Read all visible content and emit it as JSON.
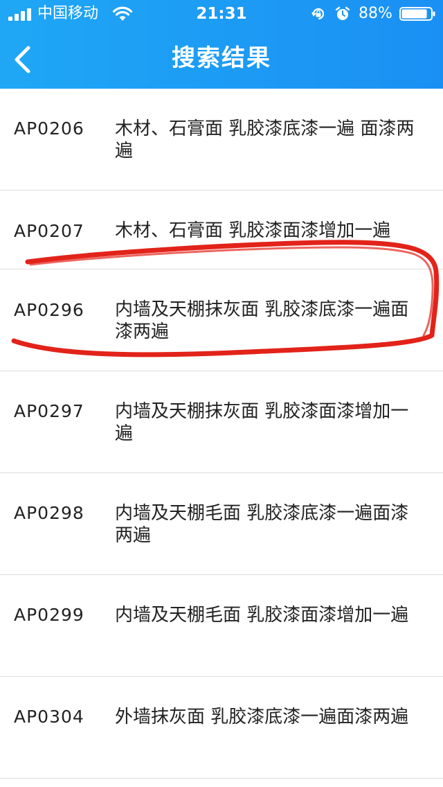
{
  "status_bar": {
    "carrier": "中国移动",
    "time": "21:31",
    "battery_percent": "88%",
    "battery_level": 0.88,
    "icons": [
      "signal-icon",
      "wifi-icon",
      "orientation-lock-icon",
      "alarm-icon",
      "battery-icon"
    ]
  },
  "nav": {
    "back_icon": "chevron-left-icon",
    "title": "搜索结果"
  },
  "results": [
    {
      "code": "AP0206",
      "desc": "木材、石膏面 乳胶漆底漆一遍 面漆两遍"
    },
    {
      "code": "AP0207",
      "desc": "木材、石膏面 乳胶漆面漆增加一遍"
    },
    {
      "code": "AP0296",
      "desc": "内墙及天棚抹灰面 乳胶漆底漆一遍面漆两遍"
    },
    {
      "code": "AP0297",
      "desc": "内墙及天棚抹灰面 乳胶漆面漆增加一遍"
    },
    {
      "code": "AP0298",
      "desc": "内墙及天棚毛面 乳胶漆底漆一遍面漆两遍"
    },
    {
      "code": "AP0299",
      "desc": "内墙及天棚毛面 乳胶漆面漆增加一遍"
    },
    {
      "code": "AP0304",
      "desc": "外墙抹灰面 乳胶漆底漆一遍面漆两遍"
    }
  ],
  "colors": {
    "header": "#1a9af5",
    "annotation": "#e2231a",
    "divider": "#dcdcdc",
    "text": "#222222"
  }
}
